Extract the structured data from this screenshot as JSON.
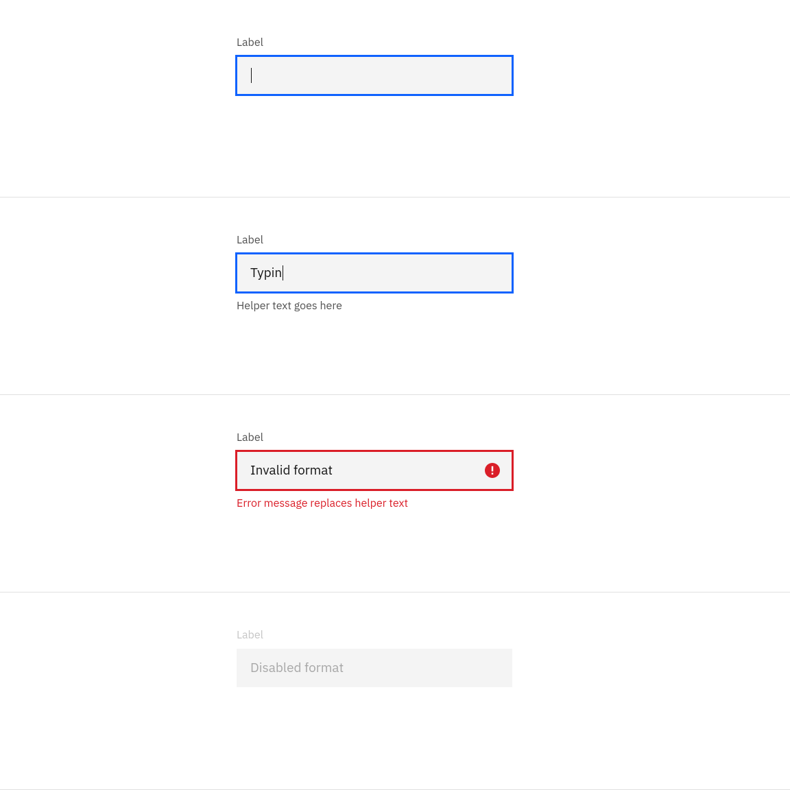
{
  "fields": [
    {
      "label": "Label",
      "value": "",
      "state": "focus-empty"
    },
    {
      "label": "Label",
      "value": "Typin",
      "helper": "Helper text goes here",
      "state": "focus-typing"
    },
    {
      "label": "Label",
      "value": "Invalid format",
      "error": "Error message replaces helper text",
      "state": "error"
    },
    {
      "label": "Label",
      "placeholder": "Disabled format",
      "state": "disabled"
    }
  ],
  "colors": {
    "focus": "#0f62fe",
    "error": "#da1e28",
    "textPrimary": "#161616",
    "textSecondary": "#525252",
    "disabled": "#c6c6c6",
    "fieldBg": "#f4f4f4"
  }
}
